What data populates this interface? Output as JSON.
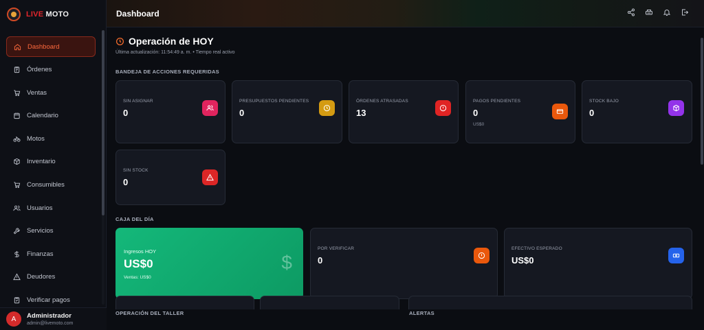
{
  "brand": {
    "part1": "LIVE",
    "part2": "MOTO"
  },
  "sidebar": {
    "items": [
      {
        "label": "Dashboard",
        "icon": "home-icon",
        "active": true
      },
      {
        "label": "Órdenes",
        "icon": "clipboard-icon"
      },
      {
        "label": "Ventas",
        "icon": "cart-icon"
      },
      {
        "label": "Calendario",
        "icon": "calendar-icon"
      },
      {
        "label": "Motos",
        "icon": "bike-icon"
      },
      {
        "label": "Inventario",
        "icon": "box-icon"
      },
      {
        "label": "Consumibles",
        "icon": "cart-icon"
      },
      {
        "label": "Usuarios",
        "icon": "users-icon"
      },
      {
        "label": "Servicios",
        "icon": "wrench-icon"
      },
      {
        "label": "Finanzas",
        "icon": "dollar-icon"
      },
      {
        "label": "Deudores",
        "icon": "warning-icon"
      },
      {
        "label": "Verificar pagos",
        "icon": "clipboard-icon"
      }
    ]
  },
  "user": {
    "initial": "A",
    "name": "Administrador",
    "email": "admin@livemoto.com"
  },
  "header": {
    "title": "Dashboard"
  },
  "page": {
    "title": "Operación de HOY",
    "subtitle": "Última actualización: 11:54:49 a. m. • Tiempo real activo"
  },
  "sections": {
    "actions": "BANDEJA DE ACCIONES REQUERIDAS",
    "cash": "CAJA DEL DÍA",
    "workshop": "OPERACIÓN DEL TALLER",
    "alerts": "ALERTAS"
  },
  "actions": [
    {
      "label": "SIN ASIGNAR",
      "value": "0",
      "color": "#e0245e",
      "icon": "users-icon"
    },
    {
      "label": "PRESUPUESTOS PENDIENTES",
      "value": "0",
      "color": "#d49b12",
      "icon": "clock-icon"
    },
    {
      "label": "ÓRDENES ATRASADAS",
      "value": "13",
      "color": "#e02424",
      "icon": "alert-circle-icon"
    },
    {
      "label": "PAGOS PENDIENTES",
      "value": "0",
      "sub": "US$0",
      "color": "#ea580c",
      "icon": "credit-card-icon"
    },
    {
      "label": "STOCK BAJO",
      "value": "0",
      "color": "#9333ea",
      "icon": "package-icon"
    },
    {
      "label": "SIN STOCK",
      "value": "0",
      "color": "#dc2626",
      "icon": "warning-icon"
    }
  ],
  "cash": {
    "income": {
      "label": "Ingresos HOY",
      "value": "US$0",
      "sub": "Ventas: US$0"
    },
    "verify": {
      "label": "POR VERIFICAR",
      "value": "0",
      "color": "#ea580c",
      "icon": "alert-circle-icon"
    },
    "expected": {
      "label": "EFECTIVO ESPERADO",
      "value": "US$0",
      "color": "#2563eb",
      "icon": "cash-icon"
    }
  }
}
